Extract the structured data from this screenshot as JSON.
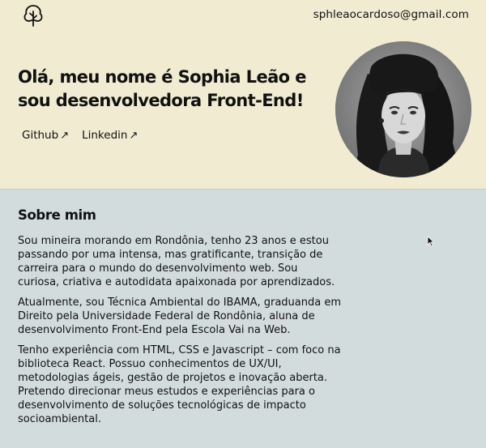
{
  "header": {
    "logo_icon": "tree-icon",
    "email": "sphleaocardoso@gmail.com"
  },
  "hero": {
    "headline": "Olá, meu nome é Sophia Leão e sou desenvolvedora Front-End!",
    "links": [
      {
        "label": "Github",
        "icon": "arrow-up-right-icon"
      },
      {
        "label": "Linkedin",
        "icon": "arrow-up-right-icon"
      }
    ],
    "photo_icon": "profile-photo"
  },
  "about": {
    "title": "Sobre mim",
    "paragraphs": [
      "Sou mineira morando em Rondônia, tenho 23 anos e estou passando por uma intensa, mas gratificante, transição de carreira para o mundo do desenvolvimento web. Sou curiosa, criativa e autodidata apaixonada por aprendizados.",
      "Atualmente, sou Técnica Ambiental do IBAMA, graduanda em Direito pela Universidade Federal de Rondônia, aluna de desenvolvimento Front-End pela Escola Vai na Web.",
      "Tenho experiência com HTML, CSS e Javascript – com foco na biblioteca React. Possuo conhecimentos de UX/UI, metodologias ágeis, gestão de projetos e inovação aberta. Pretendo direcionar meus estudos e experiências para o desenvolvimento de soluções tecnológicas de impacto socioambiental."
    ]
  },
  "colors": {
    "hero_bg": "#f1ebd2",
    "about_bg": "#d3dcdc",
    "text": "#111111"
  }
}
